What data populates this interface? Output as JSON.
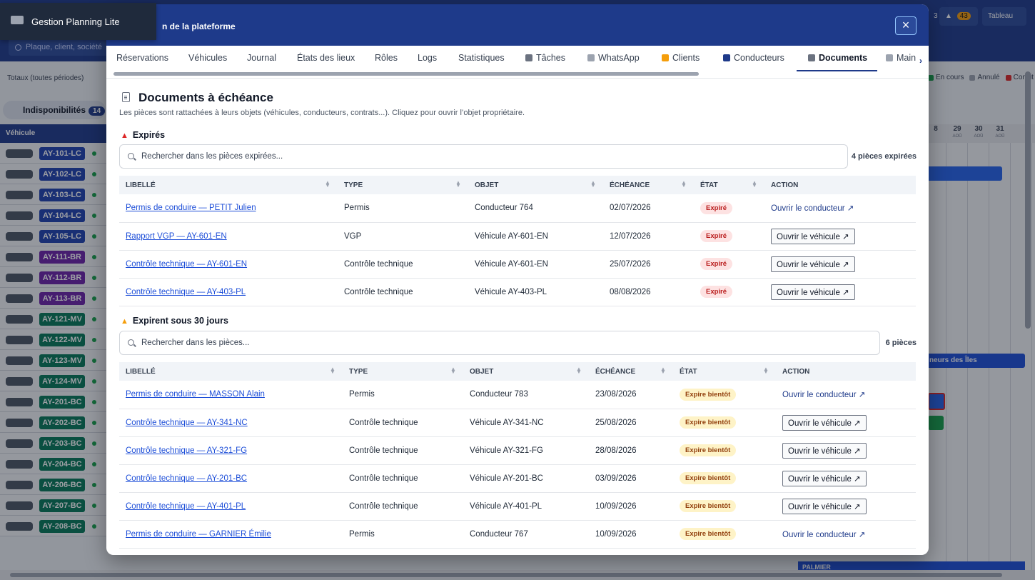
{
  "background": {
    "search_placeholder": "Plaque, client, société",
    "badge_count": "43",
    "badge_partial": "3",
    "tableau_label": "Tableau",
    "totals_label": "Totaux (toutes périodes)",
    "legend": [
      {
        "label": "En cours",
        "color": "#16a34a"
      },
      {
        "label": "Annulé",
        "color": "#9ca3af"
      },
      {
        "label": "Conflit",
        "color": "#dc2626"
      }
    ],
    "indispo_label": "Indisponibilités",
    "indispo_count": "14",
    "vehicle_col_label": "Véhicule",
    "cal_days": [
      {
        "n": "8",
        "d": ""
      },
      {
        "n": "29",
        "d": "AOÛ"
      },
      {
        "n": "30",
        "d": "AOÛ"
      },
      {
        "n": "31",
        "d": "AOÛ"
      }
    ],
    "plates": [
      {
        "p": "AY-101-LC",
        "c": "#1e40af"
      },
      {
        "p": "AY-102-LC",
        "c": "#1e40af"
      },
      {
        "p": "AY-103-LC",
        "c": "#1e40af"
      },
      {
        "p": "AY-104-LC",
        "c": "#1e40af"
      },
      {
        "p": "AY-105-LC",
        "c": "#1e40af"
      },
      {
        "p": "AY-111-BR",
        "c": "#6b21a8"
      },
      {
        "p": "AY-112-BR",
        "c": "#6b21a8"
      },
      {
        "p": "AY-113-BR",
        "c": "#6b21a8"
      },
      {
        "p": "AY-121-MV",
        "c": "#047857"
      },
      {
        "p": "AY-122-MV",
        "c": "#047857"
      },
      {
        "p": "AY-123-MV",
        "c": "#047857"
      },
      {
        "p": "AY-124-MV",
        "c": "#047857"
      },
      {
        "p": "AY-201-BC",
        "c": "#047857"
      },
      {
        "p": "AY-202-BC",
        "c": "#047857"
      },
      {
        "p": "AY-203-BC",
        "c": "#047857"
      },
      {
        "p": "AY-204-BC",
        "c": "#047857"
      },
      {
        "p": "AY-206-BC",
        "c": "#047857"
      },
      {
        "p": "AY-207-BC",
        "c": "#047857"
      },
      {
        "p": "AY-208-BC",
        "c": "#047857"
      }
    ],
    "bar_label_1": "neurs des Îles",
    "bar_label_2": "PALMIER"
  },
  "toast": {
    "text": "Gestion Planning Lite"
  },
  "modal": {
    "title": "n de la plateforme",
    "close_label": "×",
    "tabs": [
      {
        "label": "Réservations",
        "icon": ""
      },
      {
        "label": "Véhicules",
        "icon": ""
      },
      {
        "label": "Journal",
        "icon": ""
      },
      {
        "label": "États des lieux",
        "icon": ""
      },
      {
        "label": "Rôles",
        "icon": ""
      },
      {
        "label": "Logs",
        "icon": ""
      },
      {
        "label": "Statistiques",
        "icon": ""
      },
      {
        "label": "Tâches",
        "icon": "clipboard-icon"
      },
      {
        "label": "WhatsApp",
        "icon": "chat-icon"
      },
      {
        "label": "Clients",
        "icon": "handshake-icon"
      },
      {
        "label": "Conducteurs",
        "icon": "person-icon"
      },
      {
        "label": "Documents",
        "icon": "document-icon"
      },
      {
        "label": "Main",
        "icon": "wrench-icon"
      }
    ],
    "active_tab": "Documents",
    "heading": "Documents à échéance",
    "subtitle": "Les pièces sont rattachées à leurs objets (véhicules, conducteurs, contrats...). Cliquez pour ouvrir l’objet propriétaire.",
    "columns": [
      "LIBELLÉ",
      "TYPE",
      "OBJET",
      "ÉCHÉANCE",
      "ÉTAT",
      "ACTION"
    ],
    "expired": {
      "title": "Expirés",
      "search_placeholder": "Rechercher dans les pièces expirées...",
      "count_label": "4 pièces expirées",
      "rows": [
        {
          "libelle": "Permis de conduire — PETIT Julien",
          "type": "Permis",
          "objet": "Conducteur 764",
          "echeance": "02/07/2026",
          "etat": "Expiré",
          "action": "Ouvrir le conducteur ↗",
          "action_kind": "link"
        },
        {
          "libelle": "Rapport VGP — AY-601-EN",
          "type": "VGP",
          "objet": "Véhicule AY-601-EN",
          "echeance": "12/07/2026",
          "etat": "Expiré",
          "action": "Ouvrir le véhicule ↗",
          "action_kind": "button"
        },
        {
          "libelle": "Contrôle technique — AY-601-EN",
          "type": "Contrôle technique",
          "objet": "Véhicule AY-601-EN",
          "echeance": "25/07/2026",
          "etat": "Expiré",
          "action": "Ouvrir le véhicule ↗",
          "action_kind": "button"
        },
        {
          "libelle": "Contrôle technique — AY-403-PL",
          "type": "Contrôle technique",
          "objet": "Véhicule AY-403-PL",
          "echeance": "08/08/2026",
          "etat": "Expiré",
          "action": "Ouvrir le véhicule ↗",
          "action_kind": "button"
        }
      ]
    },
    "soon": {
      "title": "Expirent sous 30 jours",
      "search_placeholder": "Rechercher dans les pièces...",
      "count_label": "6 pièces",
      "rows": [
        {
          "libelle": "Permis de conduire — MASSON Alain",
          "type": "Permis",
          "objet": "Conducteur 783",
          "echeance": "23/08/2026",
          "etat": "Expire bientôt",
          "action": "Ouvrir le conducteur ↗",
          "action_kind": "link"
        },
        {
          "libelle": "Contrôle technique — AY-341-NC",
          "type": "Contrôle technique",
          "objet": "Véhicule AY-341-NC",
          "echeance": "25/08/2026",
          "etat": "Expire bientôt",
          "action": "Ouvrir le véhicule ↗",
          "action_kind": "button"
        },
        {
          "libelle": "Contrôle technique — AY-321-FG",
          "type": "Contrôle technique",
          "objet": "Véhicule AY-321-FG",
          "echeance": "28/08/2026",
          "etat": "Expire bientôt",
          "action": "Ouvrir le véhicule ↗",
          "action_kind": "button"
        },
        {
          "libelle": "Contrôle technique — AY-201-BC",
          "type": "Contrôle technique",
          "objet": "Véhicule AY-201-BC",
          "echeance": "03/09/2026",
          "etat": "Expire bientôt",
          "action": "Ouvrir le véhicule ↗",
          "action_kind": "button"
        },
        {
          "libelle": "Contrôle technique — AY-401-PL",
          "type": "Contrôle technique",
          "objet": "Véhicule AY-401-PL",
          "echeance": "10/09/2026",
          "etat": "Expire bientôt",
          "action": "Ouvrir le véhicule ↗",
          "action_kind": "button"
        },
        {
          "libelle": "Permis de conduire — GARNIER Émilie",
          "type": "Permis",
          "objet": "Conducteur 767",
          "echeance": "10/09/2026",
          "etat": "Expire bientôt",
          "action": "Ouvrir le conducteur ↗",
          "action_kind": "link"
        }
      ]
    }
  }
}
